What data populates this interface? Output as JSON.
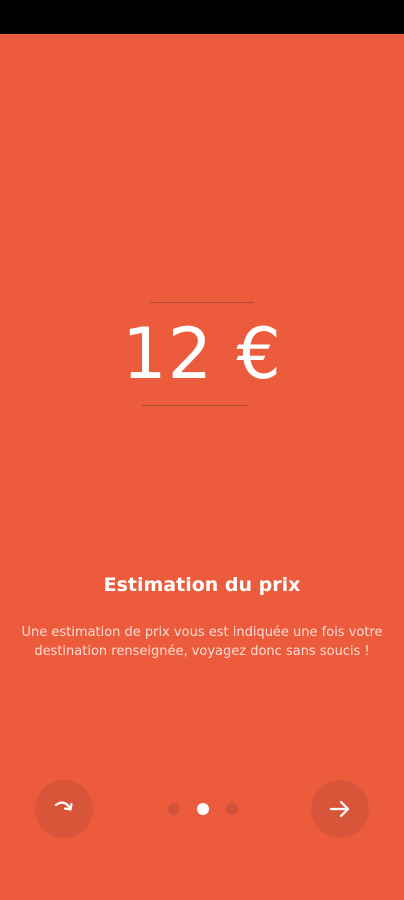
{
  "colors": {
    "background": "#ec5c3c",
    "button_bg": "#d9553a",
    "dot_inactive": "#d3533a",
    "dot_active": "#ffffff",
    "status_bar": "#000000"
  },
  "price": {
    "value": "12 €"
  },
  "slide": {
    "title": "Estimation du prix",
    "description": "Une estimation de prix vous est indiquée une fois votre destination renseignée, voyagez donc sans soucis !"
  },
  "pager": {
    "total": 3,
    "active_index": 1
  },
  "buttons": {
    "skip_icon": "redo-arrow-icon",
    "next_icon": "arrow-right-icon"
  }
}
